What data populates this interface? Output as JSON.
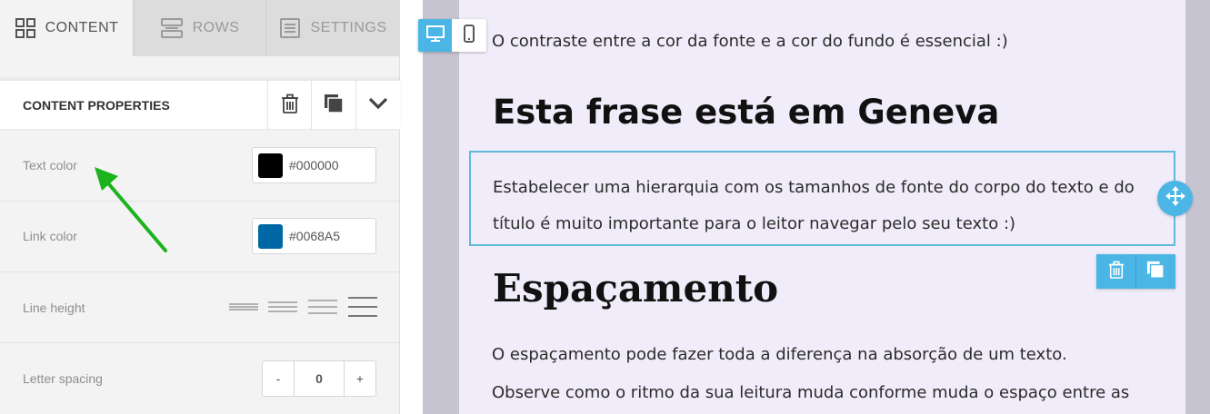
{
  "tabs": [
    {
      "label": "CONTENT",
      "icon": "grid-icon",
      "active": true
    },
    {
      "label": "ROWS",
      "icon": "rows-icon",
      "active": false
    },
    {
      "label": "SETTINGS",
      "icon": "settings-doc-icon",
      "active": false
    }
  ],
  "panel": {
    "title": "CONTENT PROPERTIES",
    "actions": [
      "trash-icon",
      "duplicate-icon",
      "chevron-down-icon"
    ]
  },
  "properties": {
    "text_color": {
      "label": "Text color",
      "value": "#000000",
      "swatch": "#000000"
    },
    "link_color": {
      "label": "Link color",
      "value": "#0068A5",
      "swatch": "#0068A5"
    },
    "line_height": {
      "label": "Line height",
      "options": 4
    },
    "letter_spacing": {
      "label": "Letter spacing",
      "minus": "-",
      "value": "0",
      "plus": "+"
    }
  },
  "editor": {
    "view_toggle": [
      "desktop-icon",
      "mobile-icon"
    ],
    "text_intro": "O contraste entre a cor da fonte e a cor do fundo é essencial :)",
    "heading_geneva": "Esta frase está em Geneva",
    "paragraph_hierarchy": "Estabelecer uma hierarquia com os tamanhos de fonte do corpo do texto e do título é muito importante para o leitor navegar pelo seu texto :)",
    "heading_spacing": "Espaçamento",
    "paragraph_spacing_1": "O espaçamento pode fazer toda a diferença na absorção de um texto.",
    "paragraph_spacing_2": "Observe como o ritmo da sua leitura muda conforme muda o espaço entre as"
  },
  "colors": {
    "accent": "#4BB6E6",
    "arrow": "#1DB31D",
    "canvas_bg": "#F1ECF9",
    "stage_bg": "#C6C4D0"
  }
}
